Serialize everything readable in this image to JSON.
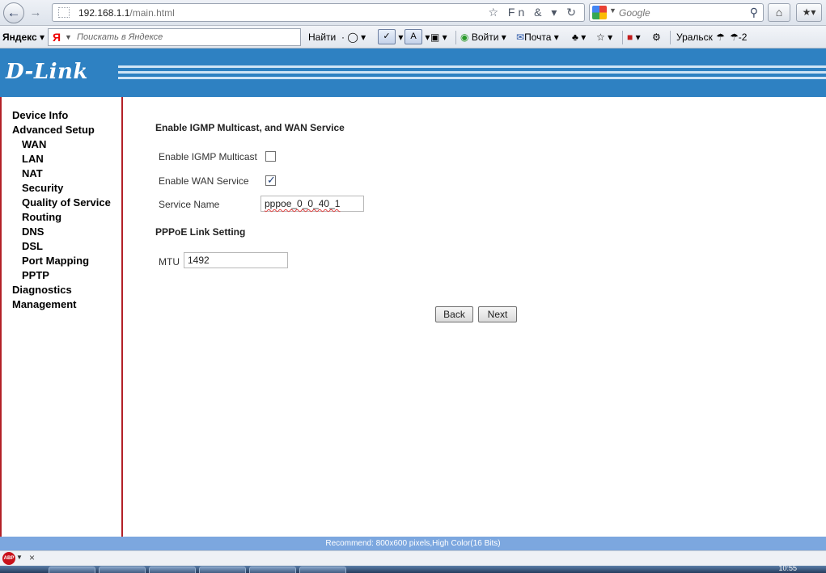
{
  "browser": {
    "url_host": "192.168.1.1",
    "url_path": "/main.html",
    "url_icons": "☆ Fn & ▾ ↻",
    "search_placeholder": "Google",
    "home_icon": "home-icon",
    "bookmarks_icon": "bookmarks-icon"
  },
  "yandex_toolbar": {
    "logo": "Яндекс",
    "search_placeholder": "Поискать в Яндексе",
    "find_label": "Найти",
    "login_label": "Войти",
    "mail_label": "Почта",
    "weather_city": "Уральск",
    "weather_temp": "-2"
  },
  "router": {
    "brand": "D-Link",
    "menu": [
      {
        "label": "Device Info",
        "level": 0
      },
      {
        "label": "Advanced Setup",
        "level": 0
      },
      {
        "label": "WAN",
        "level": 1
      },
      {
        "label": "LAN",
        "level": 1
      },
      {
        "label": "NAT",
        "level": 1
      },
      {
        "label": "Security",
        "level": 1
      },
      {
        "label": "Quality of Service",
        "level": 1
      },
      {
        "label": "Routing",
        "level": 1
      },
      {
        "label": "DNS",
        "level": 1
      },
      {
        "label": "DSL",
        "level": 1
      },
      {
        "label": "Port Mapping",
        "level": 1
      },
      {
        "label": "PPTP",
        "level": 1
      },
      {
        "label": "Diagnostics",
        "level": 0
      },
      {
        "label": "Management",
        "level": 0
      }
    ],
    "form": {
      "title": "Enable IGMP Multicast, and WAN Service",
      "igmp_label": "Enable IGMP Multicast",
      "igmp_checked": false,
      "wan_label": "Enable WAN Service",
      "wan_checked": true,
      "service_name_label": "Service Name",
      "service_name_value": "pppoe_0_0_40_1",
      "pppoe_title": "PPPoE Link Setting",
      "mtu_label": "MTU",
      "mtu_value": "1492",
      "back_label": "Back",
      "next_label": "Next"
    },
    "footer": "Recommend: 800x600 pixels,High Color(16 Bits)"
  },
  "addon_bar": {
    "abp_label": "ABP",
    "close_label": "×"
  },
  "taskbar": {
    "clock": "10:55"
  }
}
